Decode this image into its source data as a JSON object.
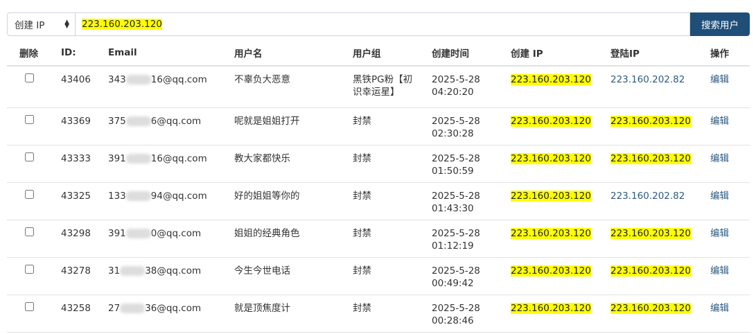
{
  "search": {
    "select_value": "创建 IP",
    "input_value": "223.160.203.120",
    "button_label": "搜索用户"
  },
  "table": {
    "headers": {
      "delete": "删除",
      "id": "ID:",
      "email": "Email",
      "username": "用户名",
      "group": "用户组",
      "created_time": "创建时间",
      "created_ip": "创建 IP",
      "login_ip": "登陆IP",
      "action": "操作"
    },
    "rows": [
      {
        "id": "43406",
        "email_prefix": "343",
        "email_suffix": "16@qq.com",
        "username": "不辜负大恶意",
        "group_line1": "黑铁PG粉【初",
        "group_line2": "识幸运星】",
        "date": "2025-5-28",
        "time": "04:20:20",
        "created_ip": "223.160.203.120",
        "login_ip": "223.160.202.82",
        "action": "编辑"
      },
      {
        "id": "43369",
        "email_prefix": "375",
        "email_suffix": "6@qq.com",
        "username": "呢就是姐姐打开",
        "group_line1": "封禁",
        "group_line2": "",
        "date": "2025-5-28",
        "time": "02:30:28",
        "created_ip": "223.160.203.120",
        "login_ip": "223.160.203.120",
        "action": "编辑"
      },
      {
        "id": "43333",
        "email_prefix": "391",
        "email_suffix": "16@qq.com",
        "username": "教大家都快乐",
        "group_line1": "封禁",
        "group_line2": "",
        "date": "2025-5-28",
        "time": "01:50:59",
        "created_ip": "223.160.203.120",
        "login_ip": "223.160.203.120",
        "action": "编辑"
      },
      {
        "id": "43325",
        "email_prefix": "133",
        "email_suffix": "94@qq.com",
        "username": "好的姐姐等你的",
        "group_line1": "封禁",
        "group_line2": "",
        "date": "2025-5-28",
        "time": "01:43:30",
        "created_ip": "223.160.203.120",
        "login_ip": "223.160.202.82",
        "action": "编辑"
      },
      {
        "id": "43298",
        "email_prefix": "391",
        "email_suffix": "0@qq.com",
        "username": "姐姐的经典角色",
        "group_line1": "封禁",
        "group_line2": "",
        "date": "2025-5-28",
        "time": "01:12:19",
        "created_ip": "223.160.203.120",
        "login_ip": "223.160.203.120",
        "action": "编辑"
      },
      {
        "id": "43278",
        "email_prefix": "31",
        "email_suffix": "38@qq.com",
        "username": "今生今世电话",
        "group_line1": "封禁",
        "group_line2": "",
        "date": "2025-5-28",
        "time": "00:49:42",
        "created_ip": "223.160.203.120",
        "login_ip": "223.160.203.120",
        "action": "编辑"
      },
      {
        "id": "43258",
        "email_prefix": "27",
        "email_suffix": "36@qq.com",
        "username": "就是顶焦度计",
        "group_line1": "封禁",
        "group_line2": "",
        "date": "2025-5-28",
        "time": "00:28:46",
        "created_ip": "223.160.203.120",
        "login_ip": "223.160.203.120",
        "action": "编辑"
      }
    ]
  },
  "colors": {
    "highlight": "#ffff00",
    "button_bg": "#1f4e79",
    "link": "#2c5a80"
  }
}
